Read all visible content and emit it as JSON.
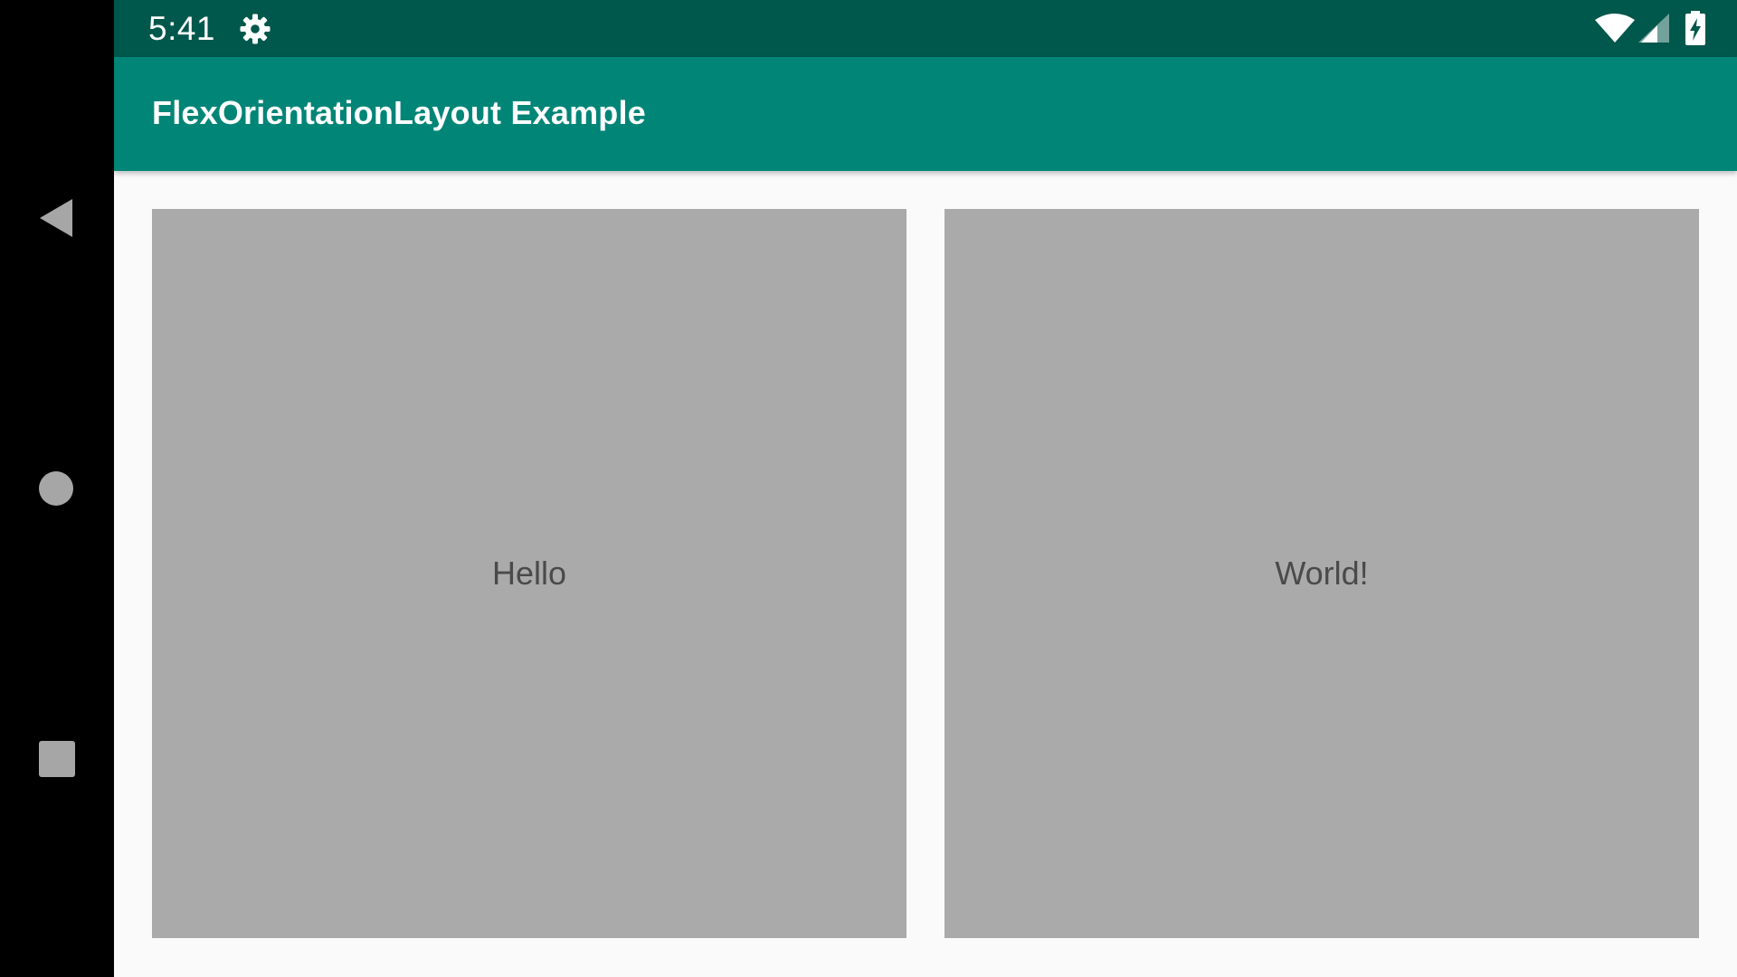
{
  "status_bar": {
    "time": "5:41",
    "icons": [
      "gear-icon",
      "wifi-icon",
      "signal-icon",
      "battery-charging-icon"
    ]
  },
  "app_bar": {
    "title": "FlexOrientationLayout Example"
  },
  "panels": [
    {
      "text": "Hello"
    },
    {
      "text": "World!"
    }
  ],
  "navigation": {
    "icons": [
      "back-icon",
      "home-icon",
      "recents-icon"
    ]
  },
  "colors": {
    "status_bar": "#00574b",
    "app_bar": "#008577",
    "panel": "#aaaaaa",
    "background": "#fafafa",
    "nav_bar": "#000000"
  }
}
